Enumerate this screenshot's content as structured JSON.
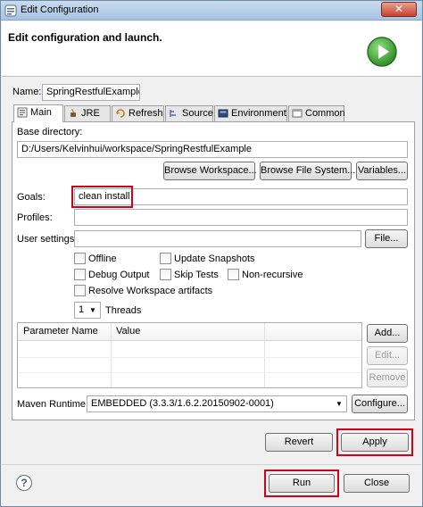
{
  "window": {
    "title": "Edit Configuration",
    "close_glyph": "✕"
  },
  "header": {
    "heading": "Edit configuration and launch."
  },
  "name": {
    "label": "Name:",
    "value": "SpringRestfulExample"
  },
  "tabs": [
    {
      "label": "Main",
      "icon": "main-tab-icon"
    },
    {
      "label": "JRE",
      "icon": "jre-icon"
    },
    {
      "label": "Refresh",
      "icon": "refresh-icon"
    },
    {
      "label": "Source",
      "icon": "source-icon"
    },
    {
      "label": "Environment",
      "icon": "environment-icon"
    },
    {
      "label": "Common",
      "icon": "common-icon"
    }
  ],
  "main": {
    "base_directory_label": "Base directory:",
    "base_directory_value": "D:/Users/Kelvinhui/workspace/SpringRestfulExample",
    "browse_workspace": "Browse Workspace...",
    "browse_file_system": "Browse File System...",
    "variables": "Variables...",
    "goals_label": "Goals:",
    "goals_value": "clean install",
    "profiles_label": "Profiles:",
    "profiles_value": "",
    "user_settings_label": "User settings:",
    "user_settings_value": "",
    "file_button": "File...",
    "options": {
      "offline": "Offline",
      "update_snapshots": "Update Snapshots",
      "debug_output": "Debug Output",
      "skip_tests": "Skip Tests",
      "non_recursive": "Non-recursive",
      "resolve_workspace": "Resolve Workspace artifacts"
    },
    "threads_value": "1",
    "threads_label": "Threads",
    "param_table": {
      "col_name": "Parameter Name",
      "col_value": "Value"
    },
    "add_button": "Add...",
    "edit_button": "Edit...",
    "remove_button": "Remove",
    "maven_runtime_label": "Maven Runtime:",
    "maven_runtime_value": "EMBEDDED (3.3.3/1.6.2.20150902-0001)",
    "configure_button": "Configure..."
  },
  "footer": {
    "revert": "Revert",
    "apply": "Apply",
    "help_glyph": "?",
    "run": "Run",
    "close": "Close"
  },
  "colors": {
    "highlight": "#d0021b",
    "run_green": "#3aa632"
  }
}
